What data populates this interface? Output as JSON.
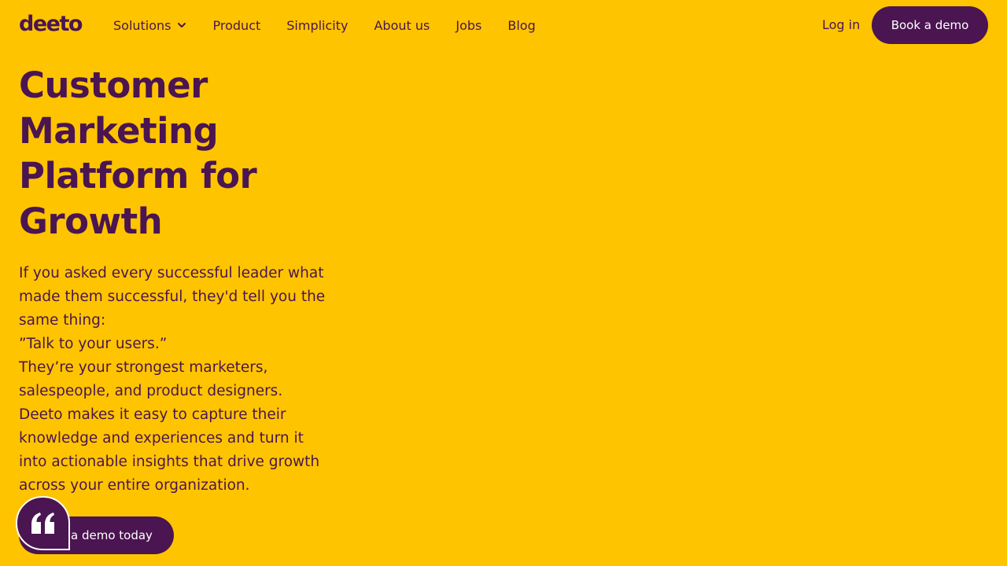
{
  "brand": {
    "logo_text": "deeto"
  },
  "nav": {
    "items": [
      {
        "label": "Solutions"
      },
      {
        "label": "Product"
      },
      {
        "label": "Simplicity"
      },
      {
        "label": "About us"
      },
      {
        "label": "Jobs"
      },
      {
        "label": "Blog"
      }
    ],
    "login_label": "Log in",
    "demo_label": "Book a demo"
  },
  "hero": {
    "title": "Customer Marketing Platform for Growth",
    "paragraphs": [
      "If you asked every successful leader what made them successful, they'd tell you the same thing:",
      "”Talk to your users.”",
      "They’re your strongest marketers, salespeople, and product designers. Deeto makes it easy to capture their knowledge and experiences and turn it into actionable insights that drive growth across your entire organization."
    ],
    "cta_label": "a demo today"
  },
  "colors": {
    "background": "#ffc400",
    "primary": "#4a1550",
    "button_text": "#ffffff"
  },
  "icons": {
    "dropdown": "chevron-down-icon",
    "widget": "quote-icon"
  }
}
